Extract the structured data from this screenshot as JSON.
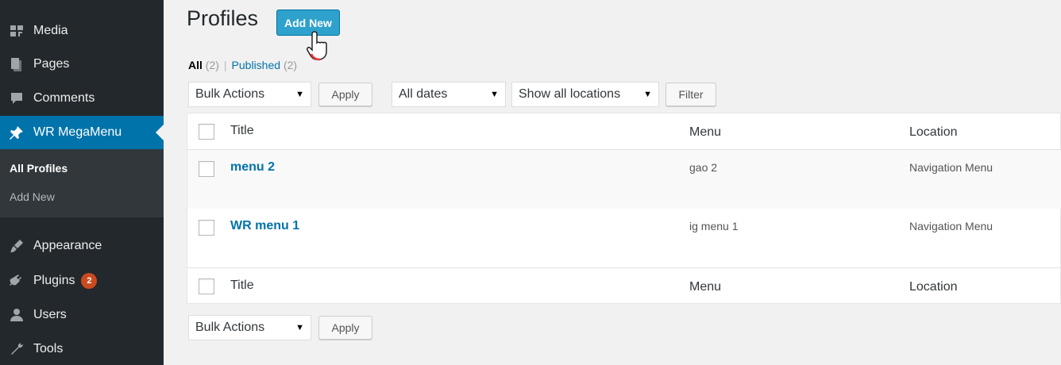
{
  "sidebar": {
    "items": [
      {
        "label": "Media",
        "icon": "media-icon"
      },
      {
        "label": "Pages",
        "icon": "pages-icon"
      },
      {
        "label": "Comments",
        "icon": "comments-icon"
      },
      {
        "label": "WR MegaMenu",
        "icon": "pin-icon",
        "active": true
      },
      {
        "label": "Appearance",
        "icon": "appearance-icon"
      },
      {
        "label": "Plugins",
        "icon": "plugins-icon",
        "badge": "2"
      },
      {
        "label": "Users",
        "icon": "users-icon"
      },
      {
        "label": "Tools",
        "icon": "tools-icon"
      }
    ],
    "submenu": [
      {
        "label": "All Profiles",
        "current": true
      },
      {
        "label": "Add New"
      }
    ]
  },
  "header": {
    "title": "Profiles",
    "add_new_label": "Add New"
  },
  "filters": {
    "all_label": "All",
    "all_count": "(2)",
    "separator": "|",
    "published_label": "Published",
    "published_count": "(2)"
  },
  "toolbar_top": {
    "bulk_actions": "Bulk Actions",
    "apply_label": "Apply",
    "dates": "All dates",
    "locations": "Show all locations",
    "filter_label": "Filter"
  },
  "table": {
    "columns": [
      "Title",
      "Menu",
      "Location"
    ],
    "rows": [
      {
        "title": "menu 2",
        "menu": "gao 2",
        "location": "Navigation Menu"
      },
      {
        "title": "WR menu 1",
        "menu": "ig menu 1",
        "location": "Navigation Menu"
      }
    ]
  },
  "toolbar_bottom": {
    "bulk_actions": "Bulk Actions",
    "apply_label": "Apply"
  },
  "colors": {
    "sidebar_bg": "#23282d",
    "active_bg": "#0073aa",
    "link": "#0073aa",
    "badge": "#ca4a1f",
    "add_new_bg": "#2ea2cc"
  }
}
